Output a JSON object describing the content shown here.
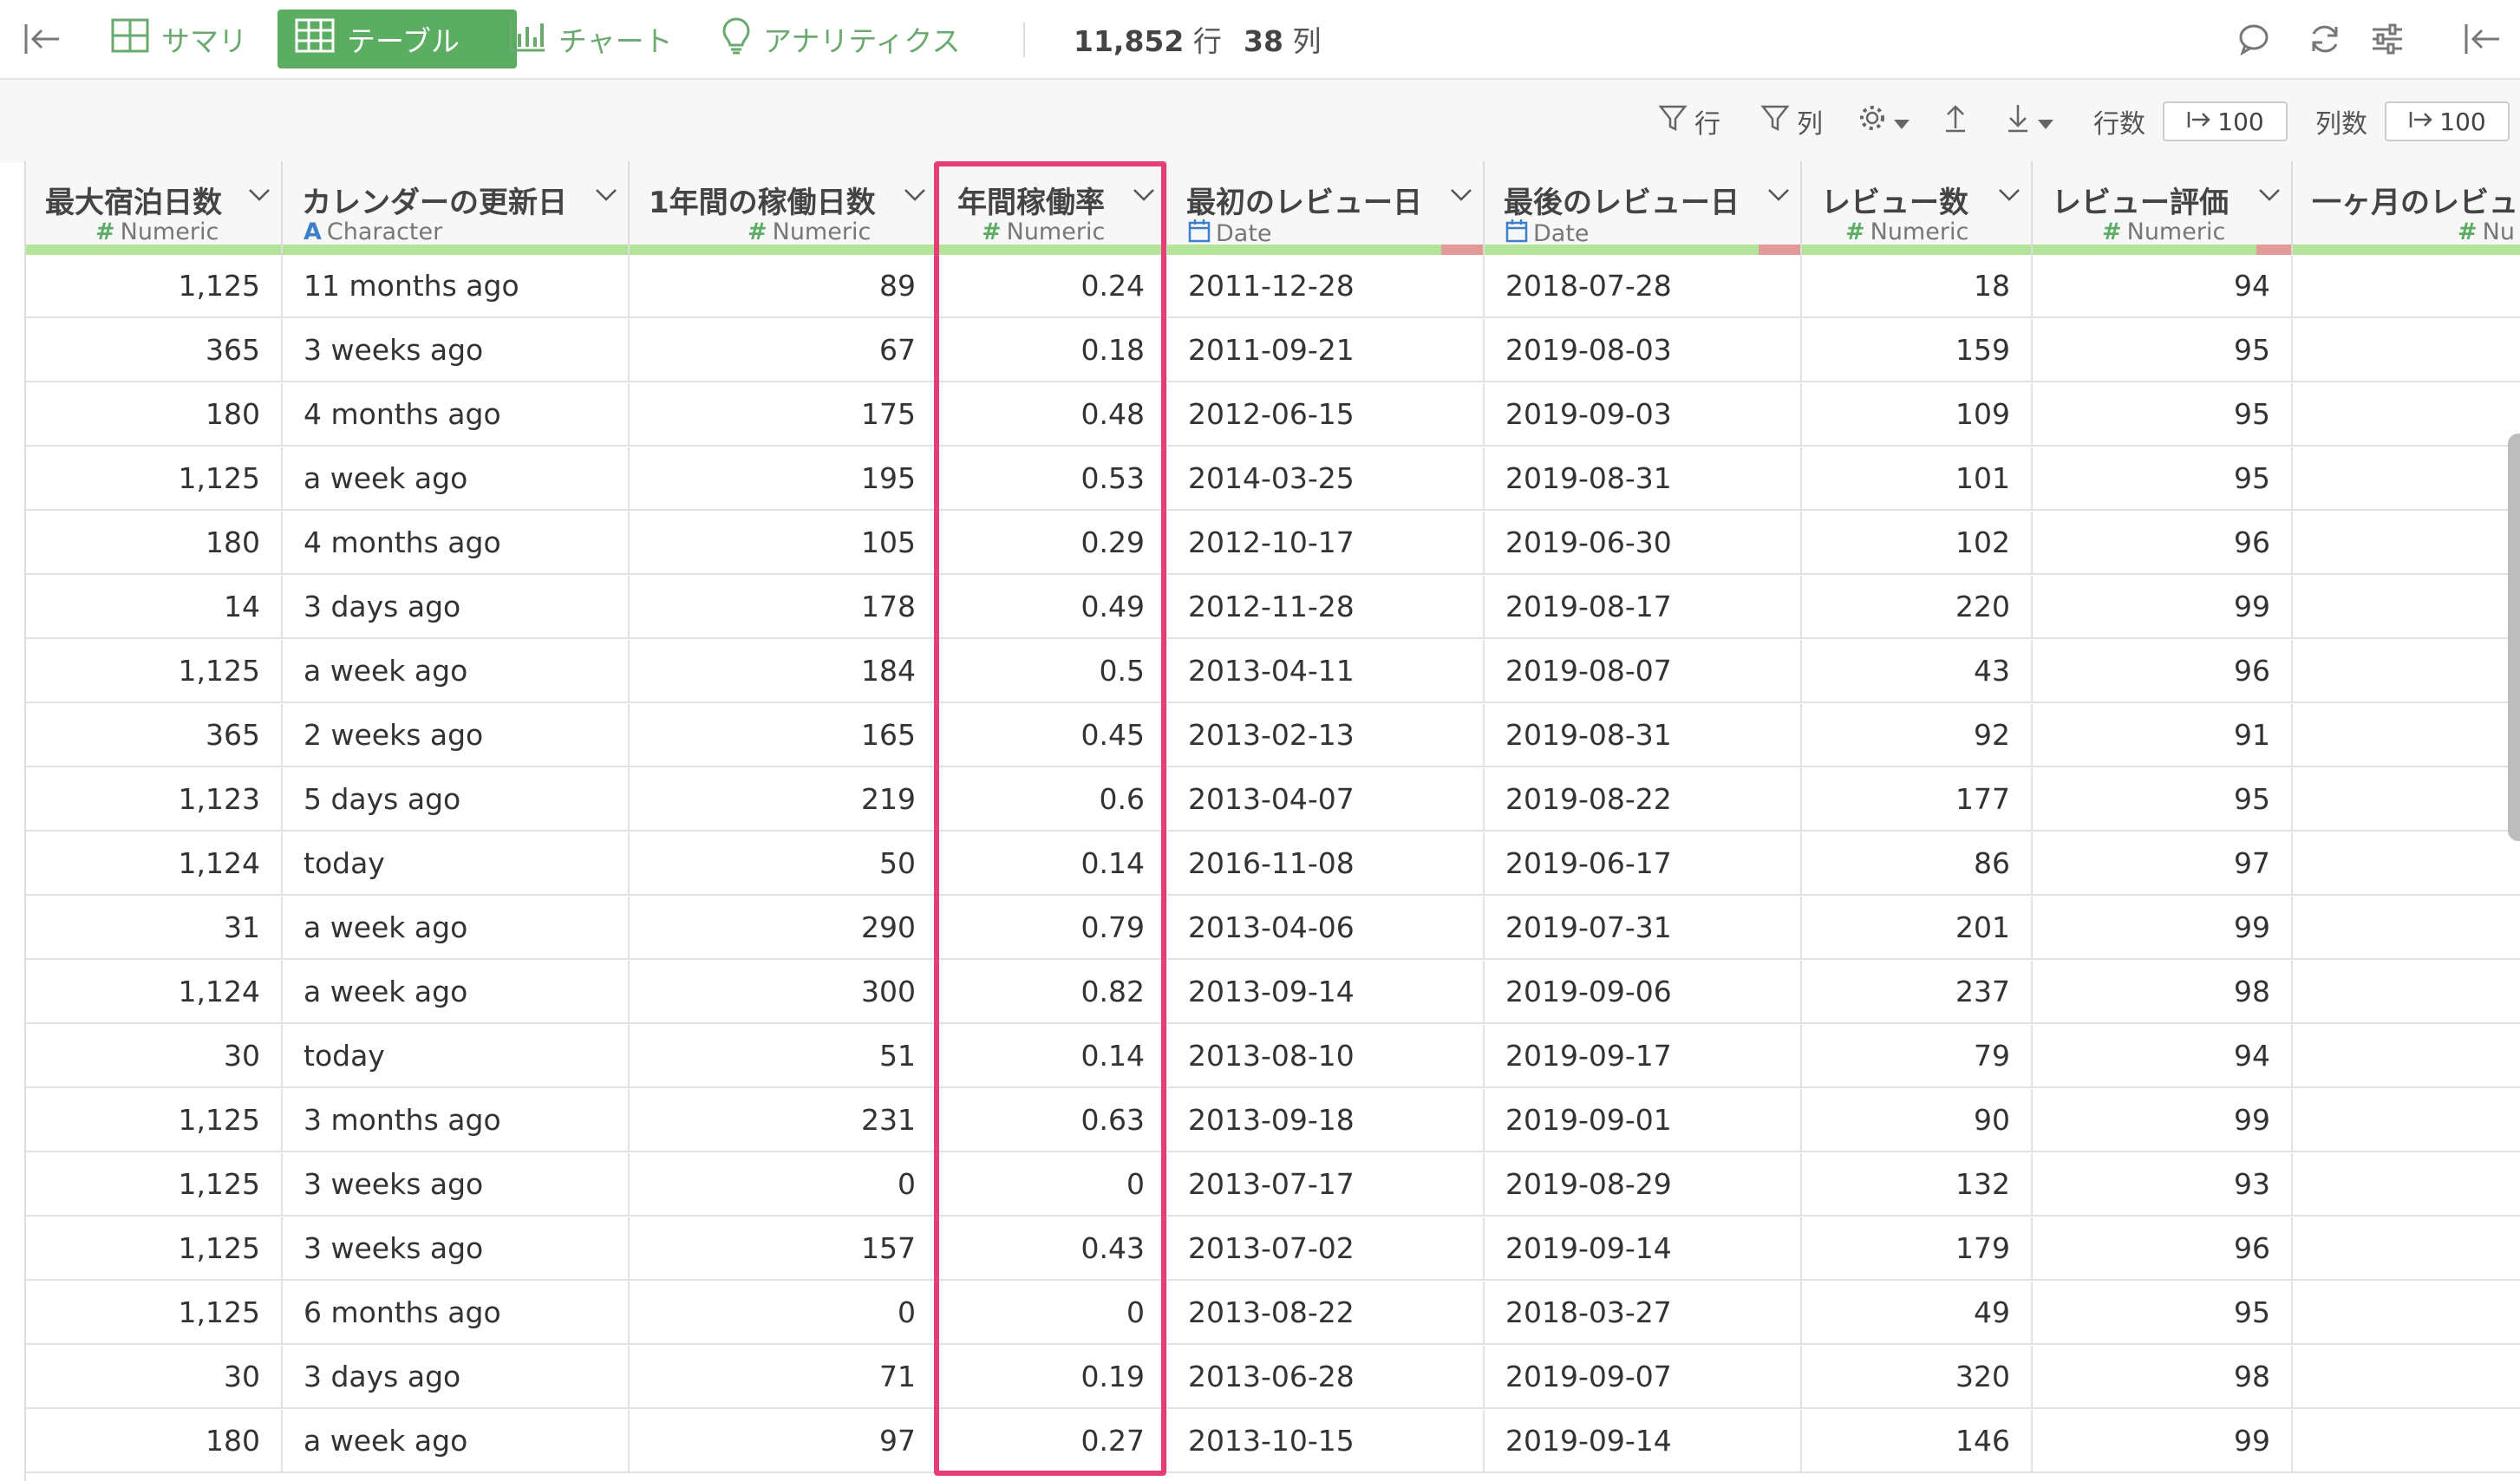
{
  "topbar": {
    "tabs": [
      {
        "label": "サマリ",
        "icon": "summary-grid-icon"
      },
      {
        "label": "テーブル",
        "icon": "table-icon",
        "active": true
      },
      {
        "label": "チャート",
        "icon": "bar-chart-icon"
      },
      {
        "label": "アナリティクス",
        "icon": "lightbulb-icon"
      }
    ],
    "row_count": "11,852",
    "row_unit": "行",
    "col_count": "38",
    "col_unit": "列"
  },
  "toolbar": {
    "filter_rows_label": "行",
    "filter_cols_label": "列",
    "rows_label": "行数",
    "rows_value": "100",
    "cols_label": "列数",
    "cols_value": "100"
  },
  "colors": {
    "accent": "#5bad62",
    "highlight": "#e53e74",
    "type_numeric": "#5bad62",
    "type_character": "#3d7fc9",
    "type_date": "#3d7fc9",
    "valid_bar": "#b4e39a",
    "missing_bar": "#e19a96"
  },
  "columns": [
    {
      "name": "最大宿泊日数",
      "type": "Numeric",
      "type_icon": "#"
    },
    {
      "name": "カレンダーの更新日",
      "type": "Character",
      "type_icon": "A"
    },
    {
      "name": "1年間の稼働日数",
      "type": "Numeric",
      "type_icon": "#"
    },
    {
      "name": "年間稼働率",
      "type": "Numeric",
      "type_icon": "#"
    },
    {
      "name": "最初のレビュー日",
      "type": "Date",
      "type_icon": "calendar"
    },
    {
      "name": "最後のレビュー日",
      "type": "Date",
      "type_icon": "calendar"
    },
    {
      "name": "レビュー数",
      "type": "Numeric",
      "type_icon": "#"
    },
    {
      "name": "レビュー評価",
      "type": "Numeric",
      "type_icon": "#"
    },
    {
      "name": "一ヶ月のレビュ",
      "type": "Nu",
      "type_icon": "#"
    }
  ],
  "rows": [
    [
      "1,125",
      "11 months ago",
      "89",
      "0.24",
      "2011-12-28",
      "2018-07-28",
      "18",
      "94",
      ""
    ],
    [
      "365",
      "3 weeks ago",
      "67",
      "0.18",
      "2011-09-21",
      "2019-08-03",
      "159",
      "95",
      ""
    ],
    [
      "180",
      "4 months ago",
      "175",
      "0.48",
      "2012-06-15",
      "2019-09-03",
      "109",
      "95",
      ""
    ],
    [
      "1,125",
      "a week ago",
      "195",
      "0.53",
      "2014-03-25",
      "2019-08-31",
      "101",
      "95",
      ""
    ],
    [
      "180",
      "4 months ago",
      "105",
      "0.29",
      "2012-10-17",
      "2019-06-30",
      "102",
      "96",
      ""
    ],
    [
      "14",
      "3 days ago",
      "178",
      "0.49",
      "2012-11-28",
      "2019-08-17",
      "220",
      "99",
      ""
    ],
    [
      "1,125",
      "a week ago",
      "184",
      "0.5",
      "2013-04-11",
      "2019-08-07",
      "43",
      "96",
      ""
    ],
    [
      "365",
      "2 weeks ago",
      "165",
      "0.45",
      "2013-02-13",
      "2019-08-31",
      "92",
      "91",
      ""
    ],
    [
      "1,123",
      "5 days ago",
      "219",
      "0.6",
      "2013-04-07",
      "2019-08-22",
      "177",
      "95",
      ""
    ],
    [
      "1,124",
      "today",
      "50",
      "0.14",
      "2016-11-08",
      "2019-06-17",
      "86",
      "97",
      ""
    ],
    [
      "31",
      "a week ago",
      "290",
      "0.79",
      "2013-04-06",
      "2019-07-31",
      "201",
      "99",
      ""
    ],
    [
      "1,124",
      "a week ago",
      "300",
      "0.82",
      "2013-09-14",
      "2019-09-06",
      "237",
      "98",
      ""
    ],
    [
      "30",
      "today",
      "51",
      "0.14",
      "2013-08-10",
      "2019-09-17",
      "79",
      "94",
      ""
    ],
    [
      "1,125",
      "3 months ago",
      "231",
      "0.63",
      "2013-09-18",
      "2019-09-01",
      "90",
      "99",
      ""
    ],
    [
      "1,125",
      "3 weeks ago",
      "0",
      "0",
      "2013-07-17",
      "2019-08-29",
      "132",
      "93",
      ""
    ],
    [
      "1,125",
      "3 weeks ago",
      "157",
      "0.43",
      "2013-07-02",
      "2019-09-14",
      "179",
      "96",
      ""
    ],
    [
      "1,125",
      "6 months ago",
      "0",
      "0",
      "2013-08-22",
      "2018-03-27",
      "49",
      "95",
      ""
    ],
    [
      "30",
      "3 days ago",
      "71",
      "0.19",
      "2013-06-28",
      "2019-09-07",
      "320",
      "98",
      ""
    ],
    [
      "180",
      "a week ago",
      "97",
      "0.27",
      "2013-10-15",
      "2019-09-14",
      "146",
      "99",
      ""
    ]
  ],
  "highlighted_column": "年間稼働率"
}
